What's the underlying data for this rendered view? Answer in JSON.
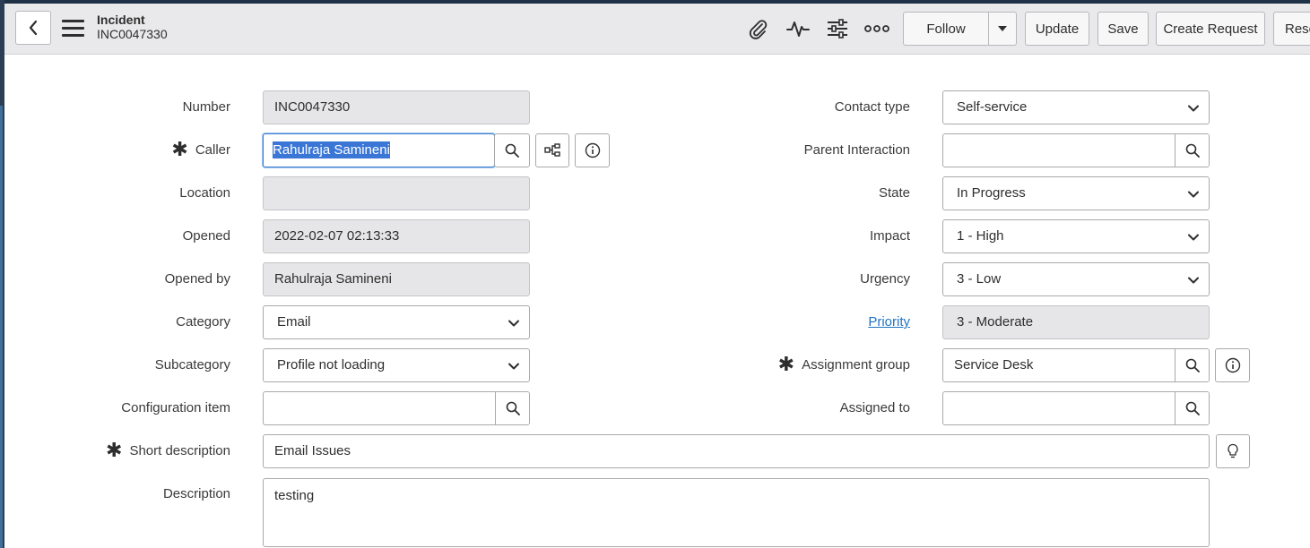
{
  "header": {
    "title": "Incident",
    "record_number": "INC0047330",
    "icons": [
      "back-icon",
      "hamburger-icon",
      "attachment-icon",
      "activity-icon",
      "personalize-form-icon",
      "more-options-icon",
      "chevron-down-icon"
    ],
    "buttons": {
      "follow": "Follow",
      "update": "Update",
      "save": "Save",
      "create_request": "Create Request",
      "resolve": "Reso"
    }
  },
  "form": {
    "number": {
      "label": "Number",
      "value": "INC0047330"
    },
    "caller": {
      "label": "Caller",
      "value": "Rahulraja Samineni",
      "required": true
    },
    "location": {
      "label": "Location",
      "value": ""
    },
    "opened": {
      "label": "Opened",
      "value": "2022-02-07 02:13:33"
    },
    "opened_by": {
      "label": "Opened by",
      "value": "Rahulraja Samineni"
    },
    "category": {
      "label": "Category",
      "value": "Email"
    },
    "subcategory": {
      "label": "Subcategory",
      "value": "Profile not loading"
    },
    "configuration_item": {
      "label": "Configuration item",
      "value": ""
    },
    "short_description": {
      "label": "Short description",
      "value": "Email Issues",
      "required": true
    },
    "description": {
      "label": "Description",
      "value": "testing"
    },
    "contact_type": {
      "label": "Contact type",
      "value": "Self-service"
    },
    "parent_interaction": {
      "label": "Parent Interaction",
      "value": ""
    },
    "state": {
      "label": "State",
      "value": "In Progress"
    },
    "impact": {
      "label": "Impact",
      "value": "1 - High"
    },
    "urgency": {
      "label": "Urgency",
      "value": "3 - Low"
    },
    "priority": {
      "label": "Priority",
      "value": "3 - Moderate"
    },
    "assignment_group": {
      "label": "Assignment group",
      "value": "Service Desk",
      "required": true
    },
    "assigned_to": {
      "label": "Assigned to",
      "value": ""
    }
  },
  "colors": {
    "header_bg": "#e9e9eb",
    "readonly_bg": "#e6e6e8",
    "link": "#1f74c4",
    "selection": "#3a76d6",
    "frame": "#1f3146"
  }
}
